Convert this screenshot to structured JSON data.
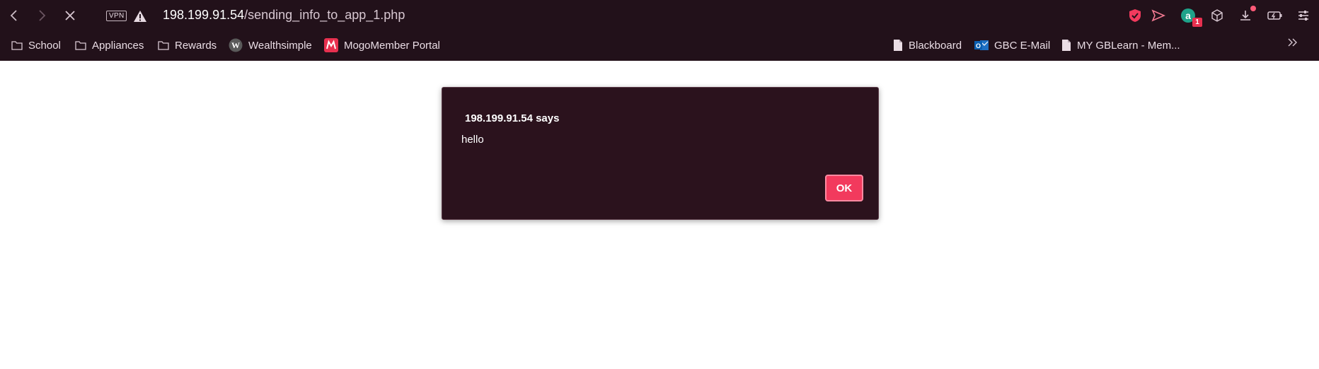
{
  "browser": {
    "vpn_label": "VPN",
    "url_host": "198.199.91.54",
    "url_path": "/sending_info_to_app_1.php",
    "extension_badge_count": "1"
  },
  "bookmarks": [
    {
      "label": "School",
      "icon": "folder-icon"
    },
    {
      "label": "Appliances",
      "icon": "folder-icon"
    },
    {
      "label": "Rewards",
      "icon": "folder-icon"
    },
    {
      "label": "Wealthsimple",
      "icon": "wealthsimple-icon"
    },
    {
      "label": "MogoMember Portal",
      "icon": "mogo-icon"
    },
    {
      "label": "Blackboard",
      "icon": "page-icon"
    },
    {
      "label": "GBC E-Mail",
      "icon": "outlook-icon"
    },
    {
      "label": "MY GBLearn - Mem...",
      "icon": "page-icon"
    }
  ],
  "dialog": {
    "title": "198.199.91.54 says",
    "message": "hello",
    "ok_label": "OK"
  },
  "colors": {
    "chrome_bg": "#22111a",
    "dialog_bg": "#2b121d",
    "accent": "#f23a5d"
  }
}
